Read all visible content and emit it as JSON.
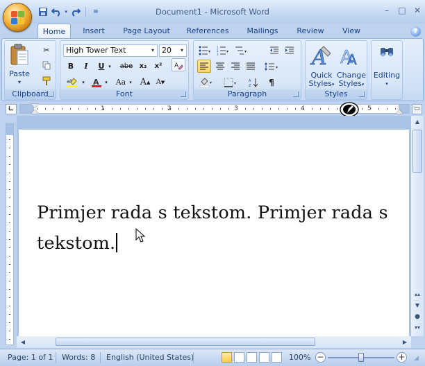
{
  "window": {
    "title": "Document1 - Microsoft Word",
    "minimize": "–",
    "maximize": "□",
    "close": "✕"
  },
  "tabs": [
    {
      "label": "Home",
      "active": true
    },
    {
      "label": "Insert"
    },
    {
      "label": "Page Layout"
    },
    {
      "label": "References"
    },
    {
      "label": "Mailings"
    },
    {
      "label": "Review"
    },
    {
      "label": "View"
    }
  ],
  "ribbon": {
    "clipboard": {
      "label": "Clipboard",
      "paste": "Paste"
    },
    "font": {
      "label": "Font",
      "font_name": "High Tower Text",
      "font_size": "20",
      "bold": "B",
      "italic": "I",
      "underline": "U",
      "strike": "abe",
      "subscript": "x₂",
      "superscript": "x²",
      "change_case": "Aa",
      "grow": "A",
      "shrink": "A"
    },
    "paragraph": {
      "label": "Paragraph"
    },
    "styles": {
      "label": "Styles",
      "quick_styles_1": "Quick",
      "quick_styles_2": "Styles",
      "change_styles_1": "Change",
      "change_styles_2": "Styles"
    },
    "editing": {
      "label": "Editing"
    }
  },
  "ruler": {
    "numbers": [
      "1",
      "1",
      "2",
      "3",
      "4",
      "5"
    ]
  },
  "document": {
    "line1": "Primjer rada s tekstom. Primjer rada s",
    "line2": "tekstom."
  },
  "status": {
    "page": "Page: 1 of 1",
    "words": "Words: 8",
    "language": "English (United States)",
    "zoom": "100%"
  }
}
